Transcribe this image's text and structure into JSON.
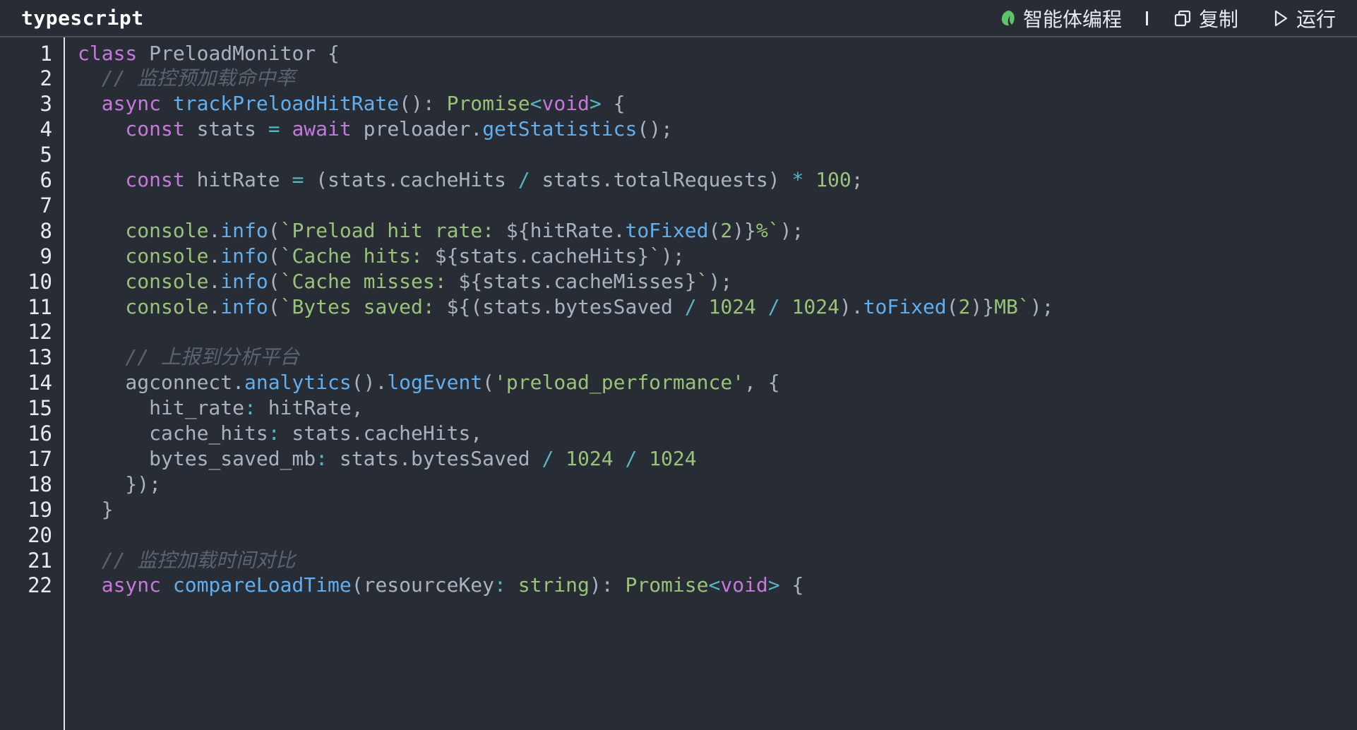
{
  "header": {
    "language": "typescript",
    "actions": {
      "agent": "智能体编程",
      "copy": "复制",
      "run": "运行"
    },
    "colors": {
      "agent_icon": "#5fc36a",
      "border": "#4b5060"
    }
  },
  "editor": {
    "line_numbers": [
      "1",
      "2",
      "3",
      "4",
      "5",
      "6",
      "7",
      "8",
      "9",
      "10",
      "11",
      "12",
      "13",
      "14",
      "15",
      "16",
      "17",
      "18",
      "19",
      "20",
      "21",
      "22"
    ],
    "lines": [
      [
        {
          "t": "class ",
          "c": "kw"
        },
        {
          "t": "PreloadMonitor",
          "c": "id"
        },
        {
          "t": " {",
          "c": "id"
        }
      ],
      [
        {
          "t": "  // 监控预加载命中率",
          "c": "cm"
        }
      ],
      [
        {
          "t": "  async ",
          "c": "kw"
        },
        {
          "t": "trackPreloadHitRate",
          "c": "fn"
        },
        {
          "t": "(): ",
          "c": "id"
        },
        {
          "t": "Promise",
          "c": "ty"
        },
        {
          "t": "<",
          "c": "op"
        },
        {
          "t": "void",
          "c": "kw"
        },
        {
          "t": ">",
          "c": "op"
        },
        {
          "t": " {",
          "c": "id"
        }
      ],
      [
        {
          "t": "    const ",
          "c": "kw"
        },
        {
          "t": "stats ",
          "c": "id"
        },
        {
          "t": "=",
          "c": "op"
        },
        {
          "t": " await ",
          "c": "kw"
        },
        {
          "t": "preloader.",
          "c": "id"
        },
        {
          "t": "getStatistics",
          "c": "fn"
        },
        {
          "t": "();",
          "c": "id"
        }
      ],
      [
        {
          "t": "",
          "c": "id"
        }
      ],
      [
        {
          "t": "    const ",
          "c": "kw"
        },
        {
          "t": "hitRate ",
          "c": "id"
        },
        {
          "t": "=",
          "c": "op"
        },
        {
          "t": " (stats.cacheHits ",
          "c": "id"
        },
        {
          "t": "/",
          "c": "op"
        },
        {
          "t": " stats.totalRequests) ",
          "c": "id"
        },
        {
          "t": "*",
          "c": "op"
        },
        {
          "t": " ",
          "c": "id"
        },
        {
          "t": "100",
          "c": "nm"
        },
        {
          "t": ";",
          "c": "id"
        }
      ],
      [
        {
          "t": "",
          "c": "id"
        }
      ],
      [
        {
          "t": "    console",
          "c": "cn"
        },
        {
          "t": ".",
          "c": "id"
        },
        {
          "t": "info",
          "c": "fn"
        },
        {
          "t": "(",
          "c": "id"
        },
        {
          "t": "`Preload hit rate: ",
          "c": "st"
        },
        {
          "t": "${hitRate.",
          "c": "id"
        },
        {
          "t": "toFixed",
          "c": "fn"
        },
        {
          "t": "(",
          "c": "id"
        },
        {
          "t": "2",
          "c": "nm"
        },
        {
          "t": ")}",
          "c": "id"
        },
        {
          "t": "%`",
          "c": "st"
        },
        {
          "t": ");",
          "c": "id"
        }
      ],
      [
        {
          "t": "    console",
          "c": "cn"
        },
        {
          "t": ".",
          "c": "id"
        },
        {
          "t": "info",
          "c": "fn"
        },
        {
          "t": "(",
          "c": "id"
        },
        {
          "t": "`Cache hits: ",
          "c": "st"
        },
        {
          "t": "${stats.cacheHits}",
          "c": "id"
        },
        {
          "t": "`",
          "c": "st"
        },
        {
          "t": ");",
          "c": "id"
        }
      ],
      [
        {
          "t": "    console",
          "c": "cn"
        },
        {
          "t": ".",
          "c": "id"
        },
        {
          "t": "info",
          "c": "fn"
        },
        {
          "t": "(",
          "c": "id"
        },
        {
          "t": "`Cache misses: ",
          "c": "st"
        },
        {
          "t": "${stats.cacheMisses}",
          "c": "id"
        },
        {
          "t": "`",
          "c": "st"
        },
        {
          "t": ");",
          "c": "id"
        }
      ],
      [
        {
          "t": "    console",
          "c": "cn"
        },
        {
          "t": ".",
          "c": "id"
        },
        {
          "t": "info",
          "c": "fn"
        },
        {
          "t": "(",
          "c": "id"
        },
        {
          "t": "`Bytes saved: ",
          "c": "st"
        },
        {
          "t": "${(stats.bytesSaved ",
          "c": "id"
        },
        {
          "t": "/",
          "c": "op"
        },
        {
          "t": " ",
          "c": "id"
        },
        {
          "t": "1024",
          "c": "nm"
        },
        {
          "t": " ",
          "c": "id"
        },
        {
          "t": "/",
          "c": "op"
        },
        {
          "t": " ",
          "c": "id"
        },
        {
          "t": "1024",
          "c": "nm"
        },
        {
          "t": ").",
          "c": "id"
        },
        {
          "t": "toFixed",
          "c": "fn"
        },
        {
          "t": "(",
          "c": "id"
        },
        {
          "t": "2",
          "c": "nm"
        },
        {
          "t": ")}",
          "c": "id"
        },
        {
          "t": "MB`",
          "c": "st"
        },
        {
          "t": ");",
          "c": "id"
        }
      ],
      [
        {
          "t": "",
          "c": "id"
        }
      ],
      [
        {
          "t": "    // 上报到分析平台",
          "c": "cm"
        }
      ],
      [
        {
          "t": "    agconnect.",
          "c": "id"
        },
        {
          "t": "analytics",
          "c": "fn"
        },
        {
          "t": "().",
          "c": "id"
        },
        {
          "t": "logEvent",
          "c": "fn"
        },
        {
          "t": "(",
          "c": "id"
        },
        {
          "t": "'preload_performance'",
          "c": "st"
        },
        {
          "t": ", {",
          "c": "id"
        }
      ],
      [
        {
          "t": "      hit_rate",
          "c": "id"
        },
        {
          "t": ":",
          "c": "op"
        },
        {
          "t": " hitRate,",
          "c": "id"
        }
      ],
      [
        {
          "t": "      cache_hits",
          "c": "id"
        },
        {
          "t": ":",
          "c": "op"
        },
        {
          "t": " stats.cacheHits,",
          "c": "id"
        }
      ],
      [
        {
          "t": "      bytes_saved_mb",
          "c": "id"
        },
        {
          "t": ":",
          "c": "op"
        },
        {
          "t": " stats.bytesSaved ",
          "c": "id"
        },
        {
          "t": "/",
          "c": "op"
        },
        {
          "t": " ",
          "c": "id"
        },
        {
          "t": "1024",
          "c": "nm"
        },
        {
          "t": " ",
          "c": "id"
        },
        {
          "t": "/",
          "c": "op"
        },
        {
          "t": " ",
          "c": "id"
        },
        {
          "t": "1024",
          "c": "nm"
        }
      ],
      [
        {
          "t": "    });",
          "c": "id"
        }
      ],
      [
        {
          "t": "  }",
          "c": "id"
        }
      ],
      [
        {
          "t": "",
          "c": "id"
        }
      ],
      [
        {
          "t": "  // 监控加载时间对比",
          "c": "cm"
        }
      ],
      [
        {
          "t": "  async ",
          "c": "kw"
        },
        {
          "t": "compareLoadTime",
          "c": "fn"
        },
        {
          "t": "(resourceKey",
          "c": "id"
        },
        {
          "t": ":",
          "c": "op"
        },
        {
          "t": " ",
          "c": "id"
        },
        {
          "t": "string",
          "c": "ty"
        },
        {
          "t": "): ",
          "c": "id"
        },
        {
          "t": "Promise",
          "c": "ty"
        },
        {
          "t": "<",
          "c": "op"
        },
        {
          "t": "void",
          "c": "kw"
        },
        {
          "t": ">",
          "c": "op"
        },
        {
          "t": " {",
          "c": "id"
        }
      ]
    ]
  }
}
